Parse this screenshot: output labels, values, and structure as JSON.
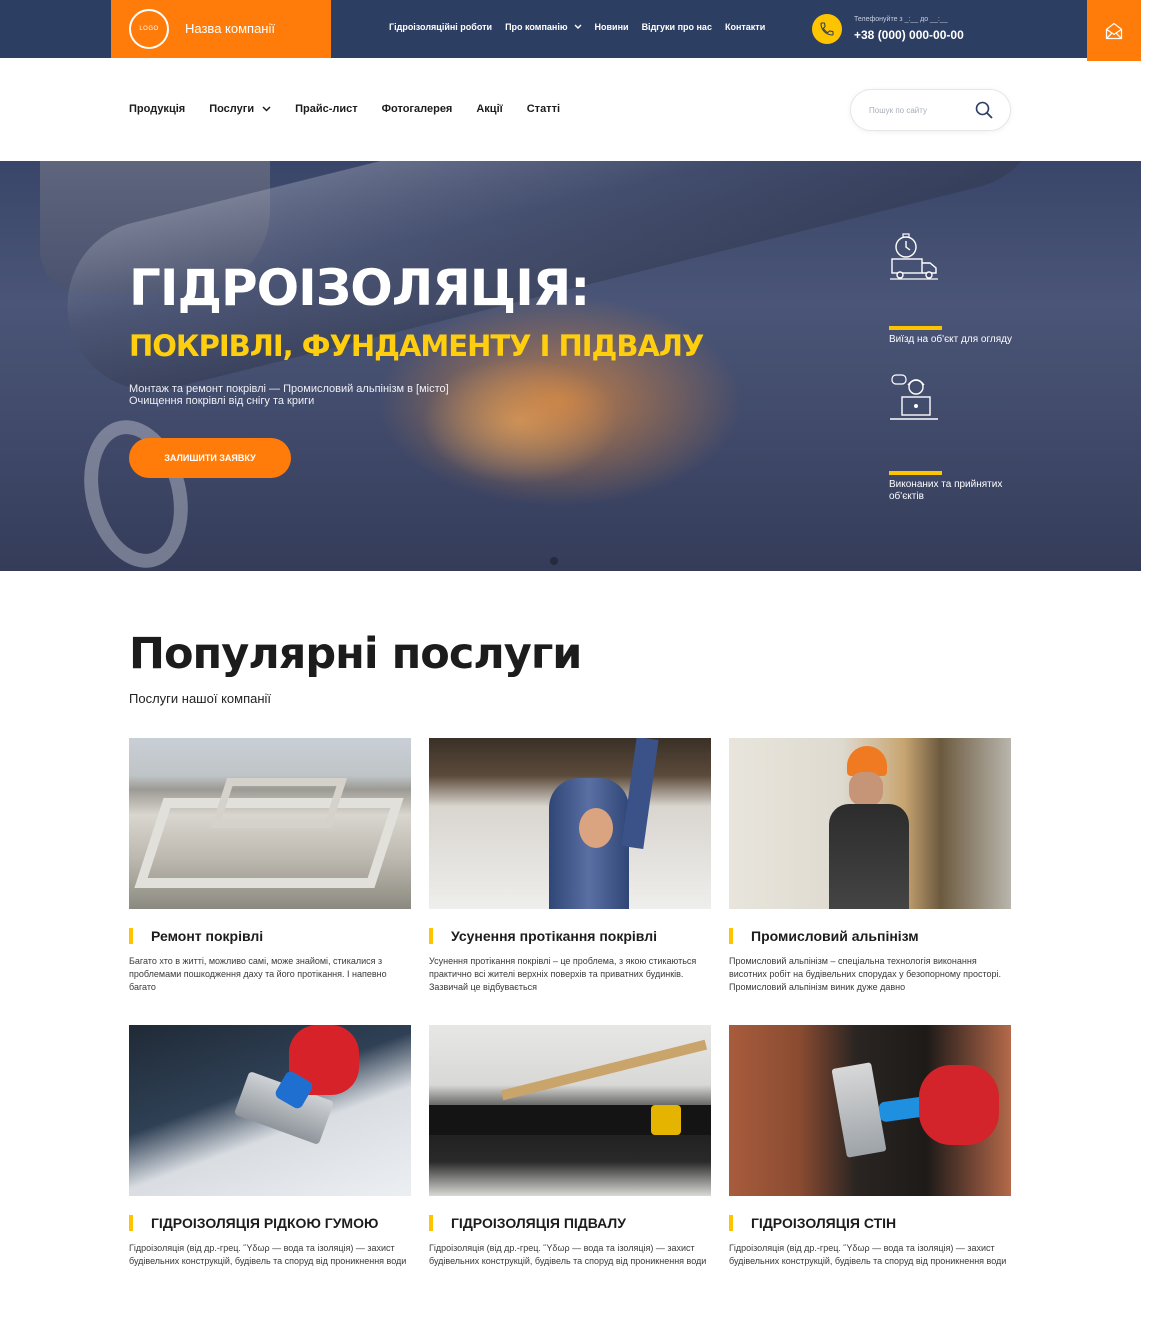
{
  "header": {
    "logo_text": "LOGO",
    "company_name": "Назва компанії",
    "nav": [
      {
        "label": "Гідроізоляційні роботи",
        "has_dropdown": false
      },
      {
        "label": "Про компанію",
        "has_dropdown": true
      },
      {
        "label": "Новини",
        "has_dropdown": false
      },
      {
        "label": "Відгуки про нас",
        "has_dropdown": false
      },
      {
        "label": "Контакти",
        "has_dropdown": false
      }
    ],
    "phone_hint": "Телефонуйте з _:__ до __:__",
    "phone_number": "+38 (000) 000-00-00",
    "icons": {
      "phone": "phone-icon",
      "mail": "mail-icon"
    },
    "colors": {
      "bar": "#2d3e63",
      "accent": "#ff7c0a",
      "yellow": "#ffc400"
    }
  },
  "subnav": {
    "items": [
      {
        "label": "Продукція",
        "has_dropdown": false
      },
      {
        "label": "Послуги",
        "has_dropdown": true
      },
      {
        "label": "Прайс-лист",
        "has_dropdown": false
      },
      {
        "label": "Фотогалерея",
        "has_dropdown": false
      },
      {
        "label": "Акції",
        "has_dropdown": false
      },
      {
        "label": "Статті",
        "has_dropdown": false
      }
    ],
    "search_placeholder": "Пошук по сайту"
  },
  "hero": {
    "title": "ГІДРОІЗОЛЯЦІЯ:",
    "subtitle": "ПОКРІВЛІ, ФУНДАМЕНТУ І ПІДВАЛУ",
    "line1": "Монтаж та ремонт покрівлі — Промисловий альпінізм в [місто]",
    "line2": "Очищення покрівлі від снігу та криги",
    "button": "ЗАЛИШИТИ ЗАЯВКУ",
    "features": [
      {
        "icon": "truck-timer-icon",
        "text": "Виїзд на об'єкт для огляду"
      },
      {
        "icon": "consultant-icon",
        "text": "Виконаних та прийнятих об'єктів"
      }
    ]
  },
  "services": {
    "title": "Популярні послуги",
    "subtitle": "Послуги нашої компанії",
    "cards": [
      {
        "title": "Ремонт покрівлі",
        "desc": "Багато хто в житті, можливо самі, може знайомі, стикалися з проблемами пошкодження даху та його протікання. І напевно багато"
      },
      {
        "title": "Усунення протікання покрівлі",
        "desc": "Усунення протікання покрівлі – це проблема, з якою стикаються практично всі жителі верхніх поверхів та приватних будинків. Зазвичай це відбувається"
      },
      {
        "title": "Промисловий альпінізм",
        "desc": "Промисловий альпінізм – спеціальна технологія виконання висотних робіт на будівельних спорудах у безопорному просторі. Промисловий альпінізм виник дуже давно"
      },
      {
        "title": "ГІДРОІЗОЛЯЦІЯ РІДКОЮ ГУМОЮ",
        "desc": "Гідроізоляція (від др.-грец. Ὕδωρ — вода та ізоляція) — захист будівельних конструкцій, будівель та споруд від проникнення води"
      },
      {
        "title": "ГІДРОІЗОЛЯЦІЯ ПІДВАЛУ",
        "desc": "Гідроізоляція (від др.-грец. Ὕδωρ — вода та ізоляція) — захист будівельних конструкцій, будівель та споруд від проникнення води"
      },
      {
        "title": "ГІДРОІЗОЛЯЦІЯ СТІН",
        "desc": "Гідроізоляція (від др.-грец. Ὕδωρ — вода та ізоляція) — захист будівельних конструкцій, будівель та споруд від проникнення води"
      }
    ]
  }
}
